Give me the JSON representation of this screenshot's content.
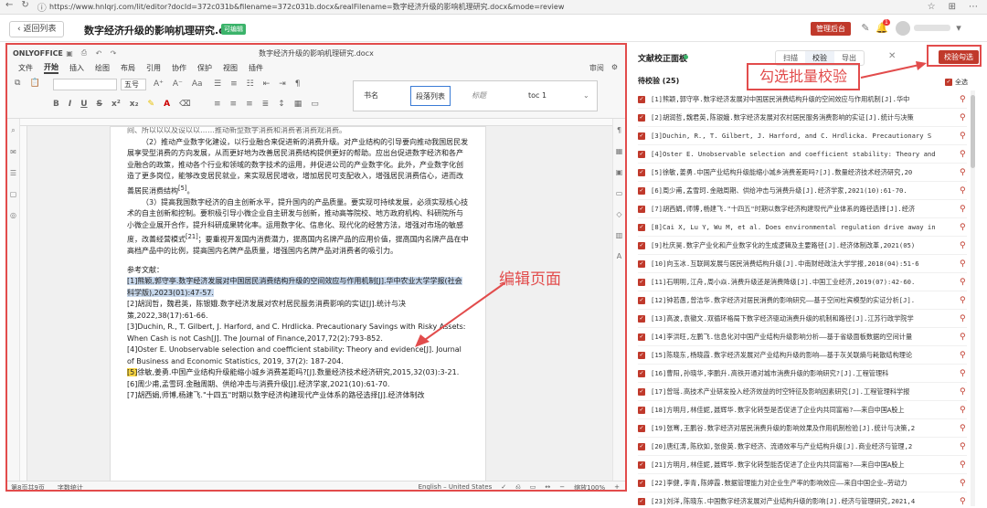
{
  "browser": {
    "url": "https://www.hnlqrj.com/lit/editor?docId=372c031b&filename=372c031b.docx&realFilename=数字经济升级的影响机理研究.docx&mode=review"
  },
  "header": {
    "back_label": "返回列表",
    "doc_title": "数字经济升级的影响机理研究.docx",
    "editable_badge": "可编辑",
    "admin_label": "管理后台",
    "notify_count": "1"
  },
  "editor": {
    "brand": "ONLYOFFICE",
    "file_title": "数字经济升级的影响机理研究.docx",
    "menus": [
      "文件",
      "开始",
      "插入",
      "绘图",
      "布局",
      "引用",
      "协作",
      "保护",
      "视图",
      "插件"
    ],
    "active_menu": "开始",
    "review_label": "审阅",
    "font_size": "五号",
    "styles": [
      "书名",
      "段落列表",
      "标题",
      "toc 1"
    ],
    "body": {
      "line0": "间、所以以以及设以以……推动新型数字消费和消费者消费观消费。",
      "para2": "（2）推动产业数字化建设，以行业融合来促进新的消费升级。对产业结构的引导要向推动我国居民发展享受型消费的方向发展，从而更好地为改善居民消费结构提供更好的帮助。应出台促进数字经济和各产业融合的政策，推动各个行业和领域的数字技术的运用，并促进公司的产业数字化。此外，产业数字化创造了更多岗位，能够改变居民就业，来实现居民增收，增加居民可支配收入，增强居民消费信心，进而改善居民消费结构",
      "para2_ref": "[5]",
      "para3": "（3）提高我国数字经济的自主创新水平，提升国内的产品质量。要实现可持续发展，必须实现核心技术的自主创新和控制。要积极引导小微企业自主研发与创新，推动高等院校、地方政府机构、科研院所与小微企业展开合作，提升科研成果转化率。运用数字化、信息化、现代化的经营方法，增强对市场的敏感度，改善经营模式",
      "para3_ref": "[21]",
      "para3b": "；要重视开发国内消费潜力，提高国内名牌产品的应用价值，提高国内名牌产品在中高档产品中的比例，提高国内名牌产品质量，增强国内名牌产品对消费者的吸引力。",
      "refs_title": "参考文献：",
      "ref1": "[1]熊颖,郭守亭.数字经济发展对中国居民消费结构升级的空间效应与作用机制[J].华中农业大学学报(社会科学版),2023(01):47-57.",
      "ref2": "[2]胡润哲，魏君英，陈银娥.数字经济发展对农村居民服务消费影响的实证[J].统计与决策,2022,38(17):61-66.",
      "ref3": "[3]Duchin, R., T. Gilbert, J. Harford, and C. Hrdlicka. Precautionary Savings with Risky Assets: When Cash is not Cash[J]. The Journal of Finance,2017,72(2):793-852.",
      "ref4": "[4]Oster E. Unobservable selection and coefficient stability: Theory and evidence[J]. Journal of Business and Economic Statistics, 2019, 37(2): 187-204.",
      "ref5a": "[5]",
      "ref5b": "徐敏,姜勇.中国产业结构升级能缩小城乡消费差距吗?[J].数量经济技术经济研究,2015,32(03):3-21.",
      "ref6": "[6]周少甫,孟雪珂.金融周期、供给冲击与消费升级[J].经济学家,2021(10):61-70.",
      "ref7": "[7]胡西娟,师博,杨建飞.\"十四五\"时期以数字经济构建现代产业体系的路径选择[J].经济体制改"
    },
    "status_left": "第8页共9页",
    "status_words": "字数统计",
    "status_lang": "English – United States",
    "status_zoom": "缩放100%"
  },
  "annotations": {
    "edit_page": "编辑页面",
    "batch_verify": "勾选批量校验"
  },
  "panel": {
    "title": "文献校正面板",
    "tabs": [
      "扫描",
      "校验",
      "导出"
    ],
    "active_tab": "校验",
    "verify_button": "校验勾选",
    "select_all": "全选",
    "pending": "待校验 (25)",
    "items": [
      "[1]熊颖,郭守亭.数字经济发展对中国居民消费结构升级的空间效应与作用机制[J].华中",
      "[2]胡润哲,魏君英,陈银娥.数字经济发展对农村居民服务消费影响的实证[J].统计与决策",
      "[3]Duchin, R., T. Gilbert, J. Harford, and C. Hrdlicka. Precautionary S",
      "[4]Oster E. Unobservable selection and coefficient stability: Theory and",
      "[5]徐敏,姜勇.中国产业结构升级能缩小城乡消费差距吗?[J].数量经济技术经济研究,20",
      "[6]周少甫,孟雪珂.金融周期、供给冲击与消费升级[J].经济学家,2021(10):61-70.",
      "[7]胡西娟,师博,杨建飞.\"十四五\"时期以数字经济构建现代产业体系的路径选择[J].经济",
      "[8]Cai X, Lu Y, Wu M, et al. Does environmental regulation drive away in",
      "[9]杜庆昊.数字产业化和产业数字化的生成逻辑及主要路径[J].经济体制改革,2021(05)",
      "[10]向玉冰.互联网发展与居民消费结构升级[J].中南财经政法大学学报,2018(04):51-6",
      "[11]石明明,江舟,周小焱.消费升级还是消费降级[J].中国工业经济,2019(07):42-60.",
      "[12]钟若愚,曾洁华.数字经济对居民消费的影响研究——基于空间杜宾模型的实证分析[J].",
      "[13]高波,袁徽文.双循环格局下数字经济驱动消费升级的机制和路径[J].江苏行政学院学",
      "[14]李洪旺,左鹏飞.信息化对中国产业结构升级影响分析——基于省级面板数据的空间计量",
      "[15]陈晓东,杨晓霞.数字经济发展对产业结构升级的影响——基于灰关联熵与耗散结构理论",
      "[16]曹阳,孙晓华,李鹏升.高铁开通对城市消费升级的影响研究?[J].工程管理科",
      "[17]曾瑶.高技术产业研发投入经济效益的时空特征及影响因素研究[J].工程管理科学报",
      "[18]方明月,林佳妮,聂辉华.数字化转型是否促进了企业内共同富裕?——来自中国A股上",
      "[19]张骞,王鹏谷.数字经济对居民消费升级的影响效果及作用机制检验[J].统计与决策,2",
      "[20]唐红涛,陈欣如,张俊英.数字经济、流通效率与产业结构升级[J].商业经济与管理,2",
      "[21]方明月,林佳妮,聂辉华.数字化转型能否促进了企业内共同富裕?——来自中国A股上",
      "[22]李健,李青,陈婷霞.数据管理能力对企业生产率的影响效应——来自中国企业—劳动力",
      "[23]刘洋,陈晓东.中国数字经济发展对产业结构升级的影响[J].经济与管理研究,2021,4"
    ]
  }
}
